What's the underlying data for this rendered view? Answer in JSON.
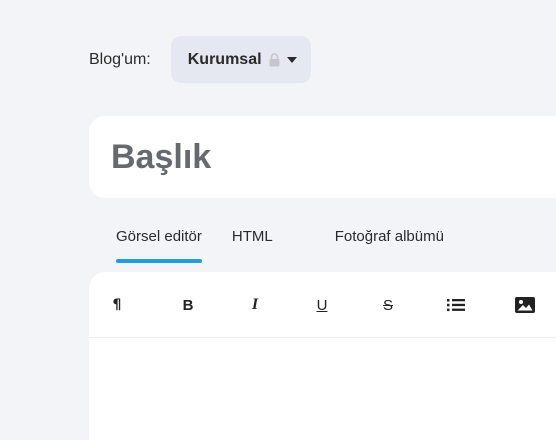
{
  "blog": {
    "label": "Blog'um:",
    "selected": "Kurumsal"
  },
  "title": {
    "placeholder": "Başlık"
  },
  "tabs": [
    {
      "label": "Görsel editör",
      "active": true
    },
    {
      "label": "HTML",
      "active": false
    },
    {
      "label": "Fotoğraf albümü",
      "active": false
    }
  ],
  "toolbar": {
    "paragraph": "¶",
    "bold": "B",
    "italic": "I",
    "underline": "U",
    "strike": "S",
    "list_icon": "list-icon",
    "image_icon": "image-icon"
  },
  "colors": {
    "background": "#f3f4f8",
    "selector_bg": "#e6e8f1",
    "accent": "#1f9bea",
    "title_text": "#666a6e"
  }
}
